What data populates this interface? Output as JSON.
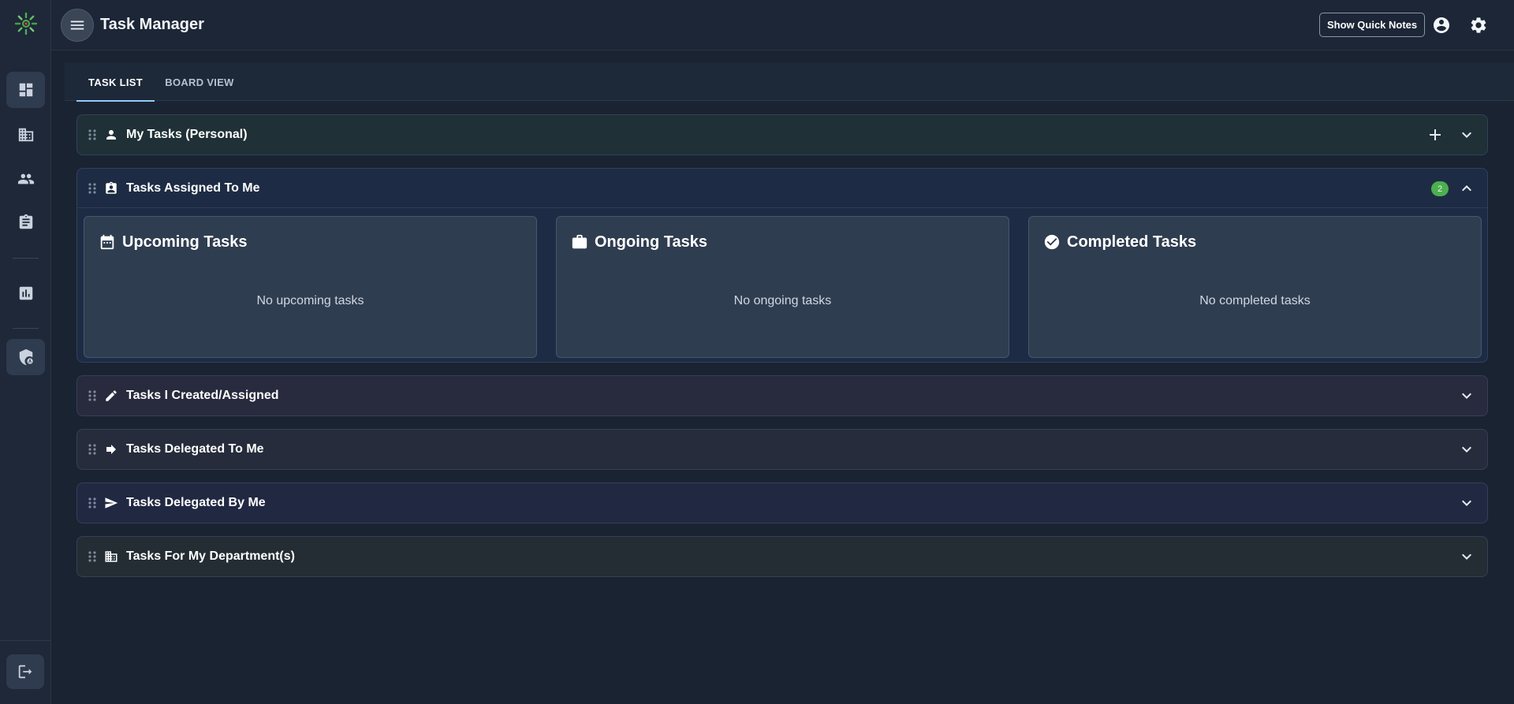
{
  "app": {
    "title": "Task Manager",
    "quick_notes_label": "Show Quick Notes"
  },
  "sidebar": {
    "items": [
      {
        "name": "dashboard",
        "icon": "dashboard-icon",
        "active": true
      },
      {
        "name": "organization",
        "icon": "building-icon",
        "active": false
      },
      {
        "name": "users",
        "icon": "people-icon",
        "active": false
      },
      {
        "name": "tasks",
        "icon": "clipboard-icon",
        "active": false
      },
      {
        "name": "reports",
        "icon": "chart-icon",
        "active": false
      },
      {
        "name": "security",
        "icon": "shield-icon",
        "active": true
      }
    ],
    "logout_icon": "logout-icon"
  },
  "tabs": [
    {
      "label": "TASK LIST",
      "active": true
    },
    {
      "label": "BOARD VIEW",
      "active": false
    }
  ],
  "sections": {
    "my_tasks": {
      "title": "My Tasks (Personal)",
      "icon": "person-icon"
    },
    "assigned": {
      "title": "Tasks Assigned To Me",
      "icon": "assignment-ind-icon",
      "badge": "2",
      "cards": {
        "upcoming": {
          "title": "Upcoming Tasks",
          "empty": "No upcoming tasks",
          "icon": "calendar-icon"
        },
        "ongoing": {
          "title": "Ongoing Tasks",
          "empty": "No ongoing tasks",
          "icon": "briefcase-icon"
        },
        "completed": {
          "title": "Completed Tasks",
          "empty": "No completed tasks",
          "icon": "check-circle-icon"
        }
      }
    },
    "created": {
      "title": "Tasks I Created/Assigned",
      "icon": "pencil-icon"
    },
    "delegated_to": {
      "title": "Tasks Delegated To Me",
      "icon": "arrow-right-icon"
    },
    "delegated_by": {
      "title": "Tasks Delegated By Me",
      "icon": "send-icon"
    },
    "department": {
      "title": "Tasks For My Department(s)",
      "icon": "building-icon"
    }
  },
  "colors": {
    "background": "#1a2332",
    "accent": "#90caf9",
    "badge": "#4caf50"
  }
}
